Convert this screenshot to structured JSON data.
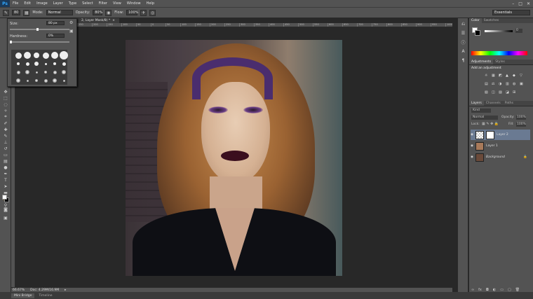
{
  "app": {
    "logo": "Ps"
  },
  "menubar": {
    "items": [
      "File",
      "Edit",
      "Image",
      "Layer",
      "Type",
      "Select",
      "Filter",
      "View",
      "Window",
      "Help"
    ],
    "controls": [
      "–",
      "□",
      "✕"
    ]
  },
  "options_bar": {
    "brush_size": "80",
    "mode_label": "Mode:",
    "mode_value": "Normal",
    "opacity_label": "Opacity:",
    "opacity_value": "80%",
    "flow_label": "Flow:",
    "flow_value": "100%",
    "workspace": "Essentials"
  },
  "document": {
    "tab_title": "2, Layer Mask/8) *",
    "close": "×",
    "ruler_ticks": [
      "250",
      "200",
      "150",
      "100",
      "50",
      "0",
      "50",
      "100",
      "150",
      "200",
      "250",
      "300",
      "350",
      "400",
      "450",
      "500",
      "550",
      "600",
      "650",
      "700",
      "750",
      "800",
      "850",
      "900",
      "950",
      "1000",
      "1050",
      "1100",
      "1150",
      "1200",
      "1250"
    ]
  },
  "status": {
    "zoom": "66.67%",
    "doc": "Doc: 4.29M/16.9M"
  },
  "bottom_tabs": [
    "Mini Bridge",
    "Timeline"
  ],
  "brush_panel": {
    "size_label": "Size:",
    "size_value": "80 px",
    "hardness_label": "Hardness:",
    "hardness_value": "0%",
    "hardness_level": 0,
    "size_level": 0.45
  },
  "panels": {
    "color_tabs": [
      "Color",
      "Swatches"
    ],
    "color_k_value": "0",
    "adjust_tabs": [
      "Adjustments",
      "Styles"
    ],
    "adjust_title": "Add an adjustment",
    "layers_tabs": [
      "Layers",
      "Channels",
      "Paths"
    ],
    "kind_label": "Kind",
    "blend_mode": "Normal",
    "opacity_label": "Opacity:",
    "opacity_value": "100%",
    "lock_label": "Lock:",
    "fill_label": "Fill:",
    "fill_value": "100%",
    "layers": [
      {
        "name": "Layer 2",
        "selected": true
      },
      {
        "name": "Layer 1",
        "selected": false
      },
      {
        "name": "Background",
        "selected": false
      }
    ]
  },
  "colors": {
    "chrome": "#535353",
    "canvas_bg": "#282828",
    "selection": "#6a7a92"
  }
}
